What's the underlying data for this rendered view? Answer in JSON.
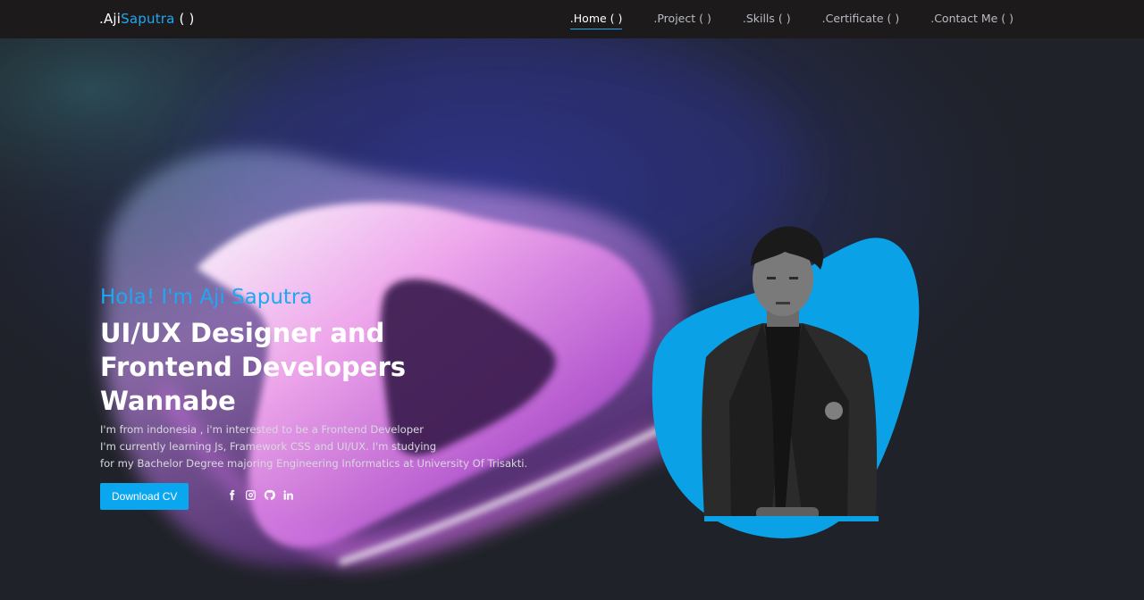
{
  "brand": {
    "prefix": ".Aji",
    "accent": "Saputra",
    "suffix": " ( )"
  },
  "nav": {
    "items": [
      {
        "label": ".Home ( )",
        "active": true
      },
      {
        "label": ".Project ( )",
        "active": false
      },
      {
        "label": ".Skills ( )",
        "active": false
      },
      {
        "label": ".Certificate ( )",
        "active": false
      },
      {
        "label": ".Contact Me ( )",
        "active": false
      }
    ]
  },
  "hero": {
    "greeting": "Hola! I'm Aji Saputra",
    "headline": "UI/UX Designer and Frontend Developers Wannabe",
    "bio": [
      "I'm from indonesia , i'm interested to be a Frontend Developer",
      "I'm currently learning Js, Framework CSS and UI/UX. I'm studying",
      "for my Bachelor Degree majoring Engineering Informatics at University Of Trisakti."
    ],
    "cta": "Download CV"
  },
  "socials": [
    {
      "icon": "facebook-icon"
    },
    {
      "icon": "instagram-icon"
    },
    {
      "icon": "github-icon"
    },
    {
      "icon": "linkedin-icon"
    }
  ],
  "colors": {
    "accent": "#1ea7f2",
    "button": "#0ba6f0",
    "navbar": "#1c1a1b",
    "background": "#1f2228",
    "blob": "#0aa1e6"
  }
}
